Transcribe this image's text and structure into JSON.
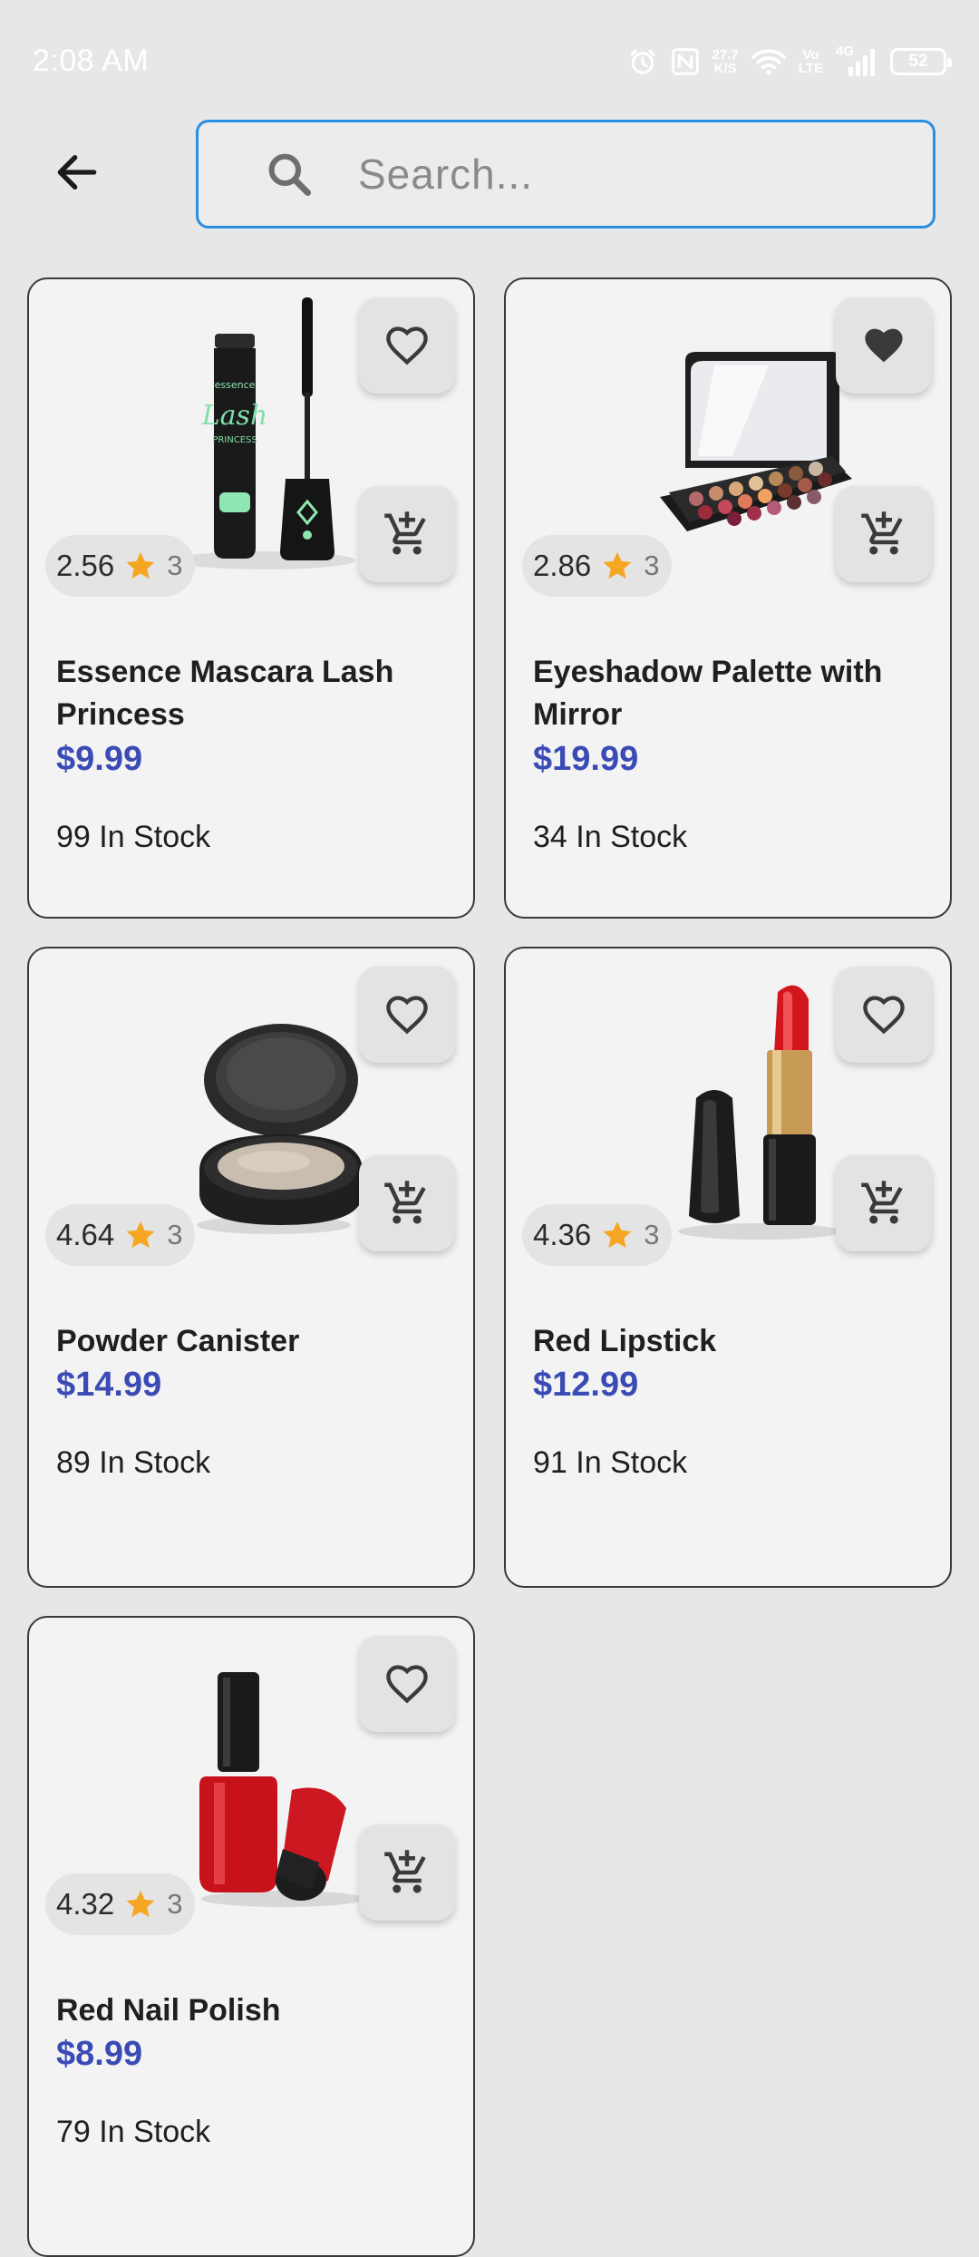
{
  "status_bar": {
    "time": "2:08 AM",
    "net_speed_value": "27.7",
    "net_speed_unit": "K/S",
    "volte_top": "Vo",
    "volte_bottom": "LTE",
    "signal_label": "4G",
    "battery": "52",
    "icons": [
      "alarm-icon",
      "nfc-icon",
      "wifi-icon",
      "signal-icon",
      "battery-icon"
    ],
    "color": "#ffffff"
  },
  "header": {
    "back_icon": "arrow-left-icon",
    "search": {
      "placeholder": "Search...",
      "value": "",
      "icon": "search-icon",
      "border_color": "#2a8ee0"
    }
  },
  "colors": {
    "price": "#3b4bb5",
    "star": "#f5a623",
    "card_bg": "#f3f3f3",
    "page_bg": "#e7e7e7"
  },
  "products": [
    {
      "title": "Essence Mascara Lash Princess",
      "price": "$9.99",
      "stock": "99 In Stock",
      "rating": "2.56",
      "rating_count": "3",
      "favorited": false,
      "image": "mascara"
    },
    {
      "title": "Eyeshadow Palette with Mirror",
      "price": "$19.99",
      "stock": "34 In Stock",
      "rating": "2.86",
      "rating_count": "3",
      "favorited": true,
      "image": "eyeshadow-palette"
    },
    {
      "title": "Powder Canister",
      "price": "$14.99",
      "stock": "89 In Stock",
      "rating": "4.64",
      "rating_count": "3",
      "favorited": false,
      "image": "powder-canister"
    },
    {
      "title": "Red Lipstick",
      "price": "$12.99",
      "stock": "91 In Stock",
      "rating": "4.36",
      "rating_count": "3",
      "favorited": false,
      "image": "lipstick"
    },
    {
      "title": "Red Nail Polish",
      "price": "$8.99",
      "stock": "79 In Stock",
      "rating": "4.32",
      "rating_count": "3",
      "favorited": false,
      "image": "nail-polish"
    }
  ]
}
